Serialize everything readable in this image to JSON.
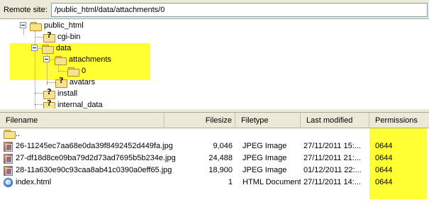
{
  "site_bar": {
    "label": "Remote site:",
    "path": "/public_html/data/attachments/0"
  },
  "tree": {
    "nodes": [
      {
        "name": "public_html",
        "icon": "folder-open-icon",
        "expanded": true
      },
      {
        "name": "cgi-bin",
        "icon": "folder-unknown-icon"
      },
      {
        "name": "data",
        "icon": "folder-open-icon",
        "expanded": true,
        "highlighted": true
      },
      {
        "name": "attachments",
        "icon": "folder-open-icon",
        "expanded": true,
        "highlighted": true
      },
      {
        "name": "0",
        "icon": "folder-open-icon",
        "selected": true,
        "highlighted": true
      },
      {
        "name": "avatars",
        "icon": "folder-unknown-icon"
      },
      {
        "name": "install",
        "icon": "folder-unknown-icon"
      },
      {
        "name": "internal_data",
        "icon": "folder-unknown-icon"
      }
    ]
  },
  "file_list": {
    "columns": {
      "filename": "Filename",
      "filesize": "Filesize",
      "filetype": "Filetype",
      "modified": "Last modified",
      "permissions": "Permissions"
    },
    "rows": [
      {
        "icon": "parent-folder-icon",
        "filename": "..",
        "filesize": "",
        "filetype": "",
        "modified": "",
        "permissions": ""
      },
      {
        "icon": "jpeg-file-icon",
        "filename": "26-11245ec7aa68e0da39f8492452d449fa.jpg",
        "filesize": "9,046",
        "filetype": "JPEG Image",
        "modified": "27/11/2011 15:...",
        "permissions": "0644"
      },
      {
        "icon": "jpeg-file-icon",
        "filename": "27-df18d8ce09ba79d2d73ad7695b5b234e.jpg",
        "filesize": "24,488",
        "filetype": "JPEG Image",
        "modified": "27/11/2011 21:...",
        "permissions": "0644"
      },
      {
        "icon": "jpeg-file-icon",
        "filename": "28-11a630e90c93caa8ab41c0390a0eff65.jpg",
        "filesize": "18,900",
        "filetype": "JPEG Image",
        "modified": "01/12/2011 22:...",
        "permissions": "0644"
      },
      {
        "icon": "html-file-icon",
        "filename": "index.html",
        "filesize": "1",
        "filetype": "HTML Document",
        "modified": "27/11/2011 14:...",
        "permissions": "0644"
      }
    ]
  },
  "colors": {
    "highlight": "#ffff33",
    "chrome": "#ece9d8",
    "input_border": "#7f9db9"
  }
}
